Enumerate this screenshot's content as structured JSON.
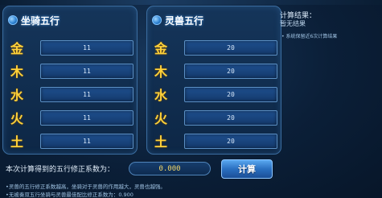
{
  "mount_panel": {
    "title": "坐骑五行",
    "icon": "orb-icon",
    "rows": [
      {
        "element": "金",
        "value": "11"
      },
      {
        "element": "木",
        "value": "11"
      },
      {
        "element": "水",
        "value": "11"
      },
      {
        "element": "火",
        "value": "11"
      },
      {
        "element": "土",
        "value": "11"
      }
    ]
  },
  "beast_panel": {
    "title": "灵兽五行",
    "icon": "orb-icon",
    "rows": [
      {
        "element": "金",
        "value": "20"
      },
      {
        "element": "木",
        "value": "20"
      },
      {
        "element": "水",
        "value": "20"
      },
      {
        "element": "火",
        "value": "20"
      },
      {
        "element": "土",
        "value": "20"
      }
    ]
  },
  "result": {
    "title": "计算结果：",
    "text": "暂无结果",
    "note": "• 系统保留近6次计算结果"
  },
  "coefficient": {
    "label": "本次计算得到的五行修正系数为：",
    "value": "0.000"
  },
  "calc_button": {
    "label": "计算"
  },
  "notes": [
    "•灵兽的五行修正系数越高，坐骑对于灵兽的作用越大，灵兽也越强。",
    "•无被奏双五行坐骑与灵兽最佳配比修正系数为：0.900"
  ],
  "colors": {
    "background": "#0b1f38",
    "element_text": "#ffd23a",
    "field": "#1e4f8e",
    "button": "#2a6fc0"
  }
}
